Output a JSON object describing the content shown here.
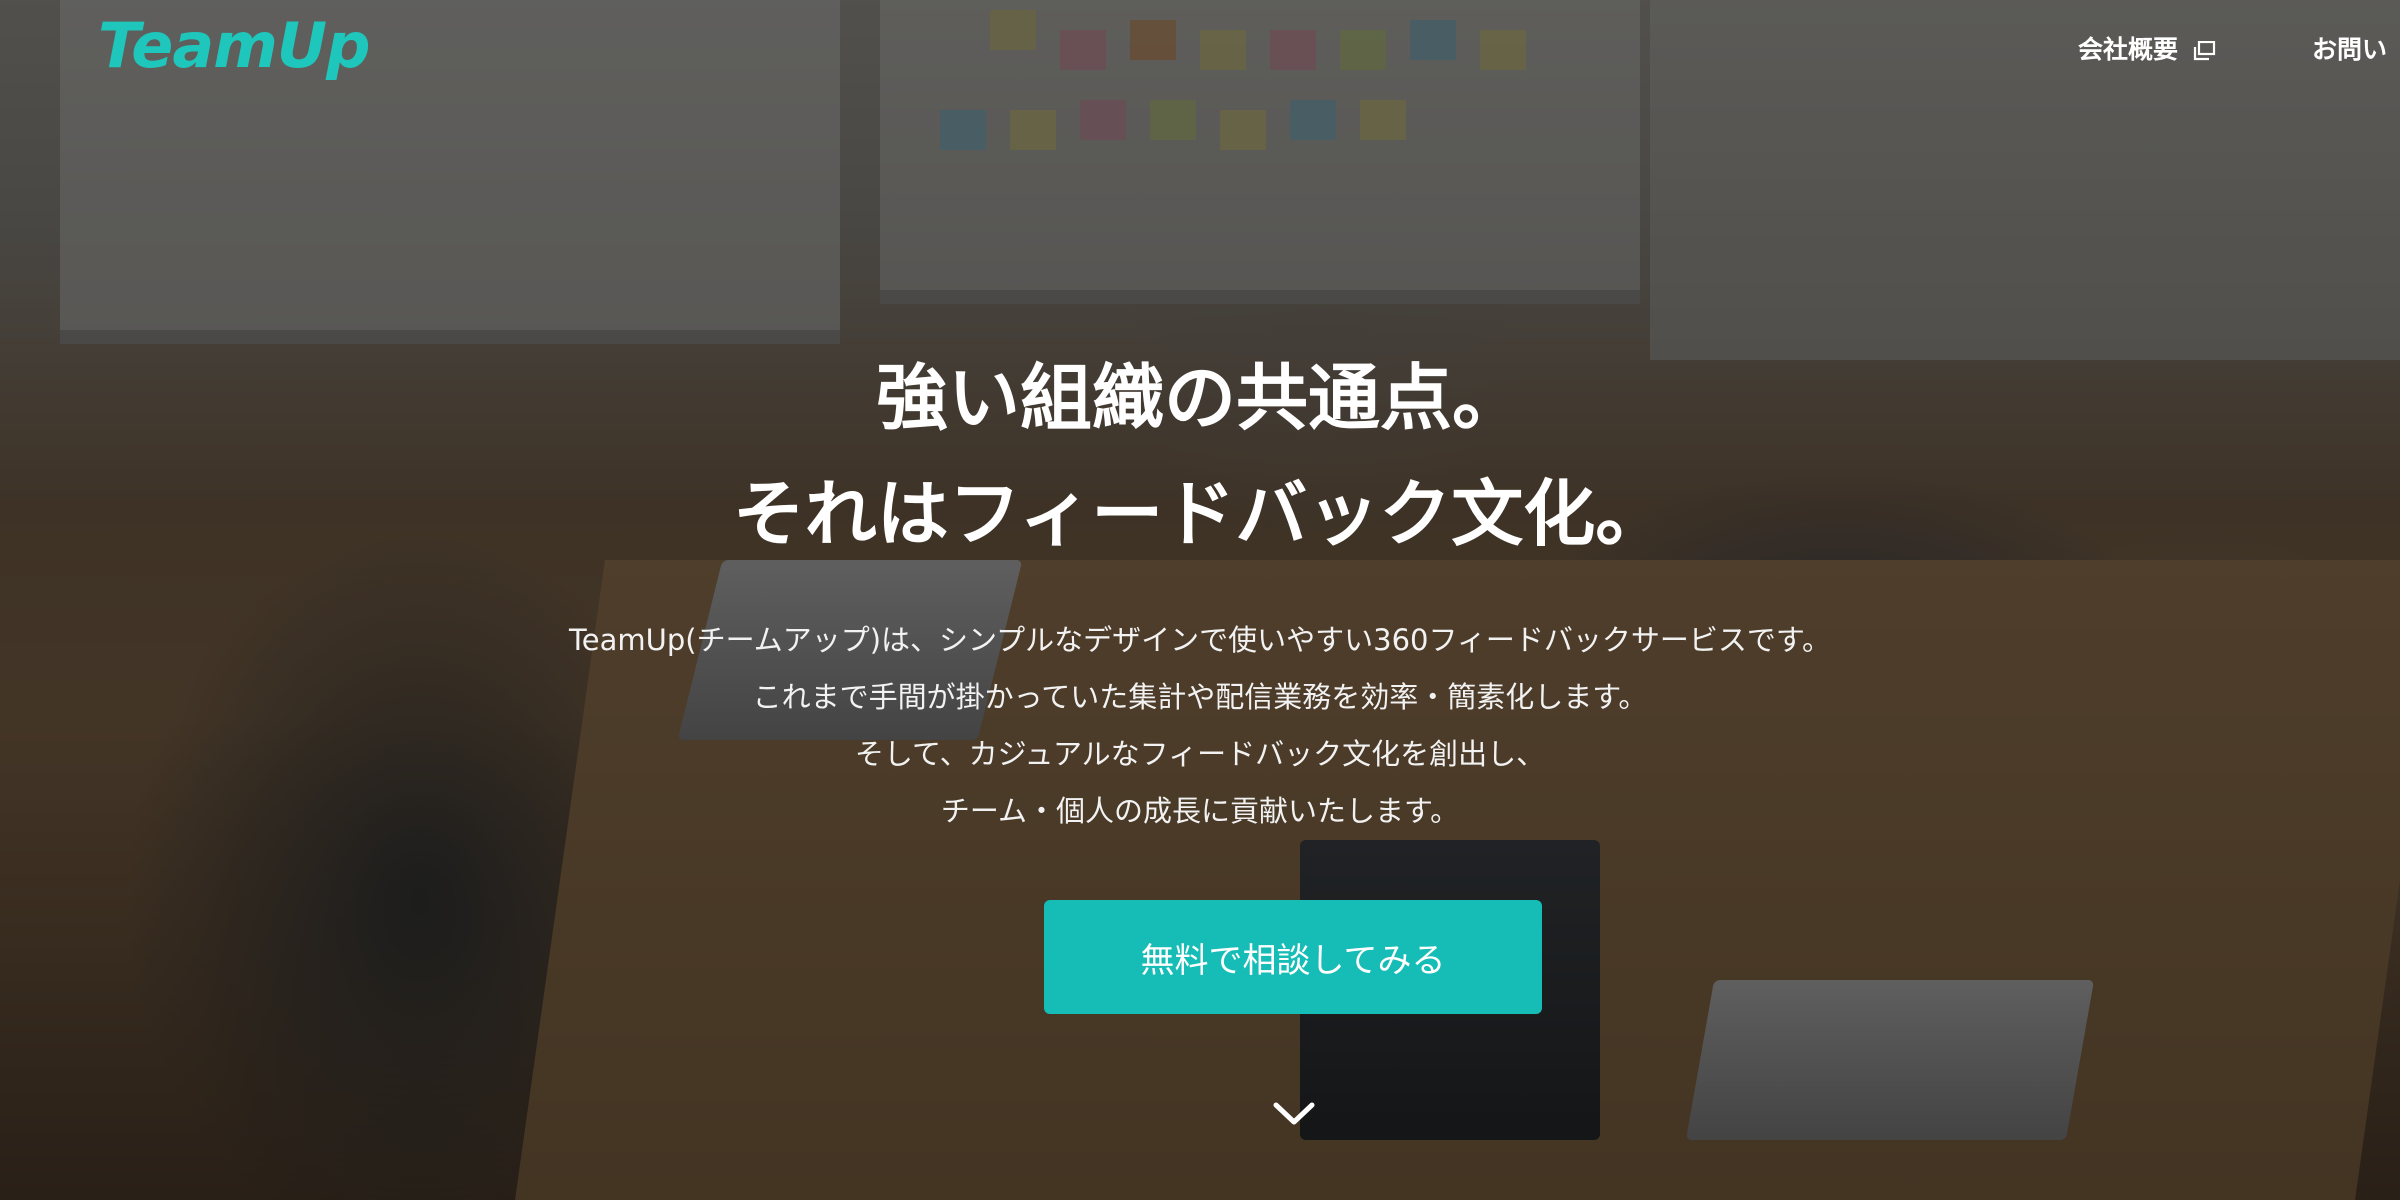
{
  "header": {
    "logo_text": "TeamUp",
    "nav": [
      {
        "label": "会社概要",
        "icon": "external-link-icon"
      },
      {
        "label": "お問い"
      }
    ]
  },
  "hero": {
    "headline_line1": "強い組織の共通点。",
    "headline_line2": "それはフィードバック文化。",
    "description_lines": [
      "TeamUp(チームアップ)は、シンプルなデザインで使いやすい360フィードバックサービスです。",
      "これまで手間が掛かっていた集計や配信業務を効率・簡素化します。",
      "そして、カジュアルなフィードバック文化を創出し、",
      "チーム・個人の成長に貢献いたします。"
    ],
    "cta_label": "無料で相談してみる",
    "scroll_icon": "chevron-down-icon"
  },
  "colors": {
    "brand": "#1ec6bc",
    "cta_background": "#16bdb6",
    "text": "#ffffff"
  }
}
